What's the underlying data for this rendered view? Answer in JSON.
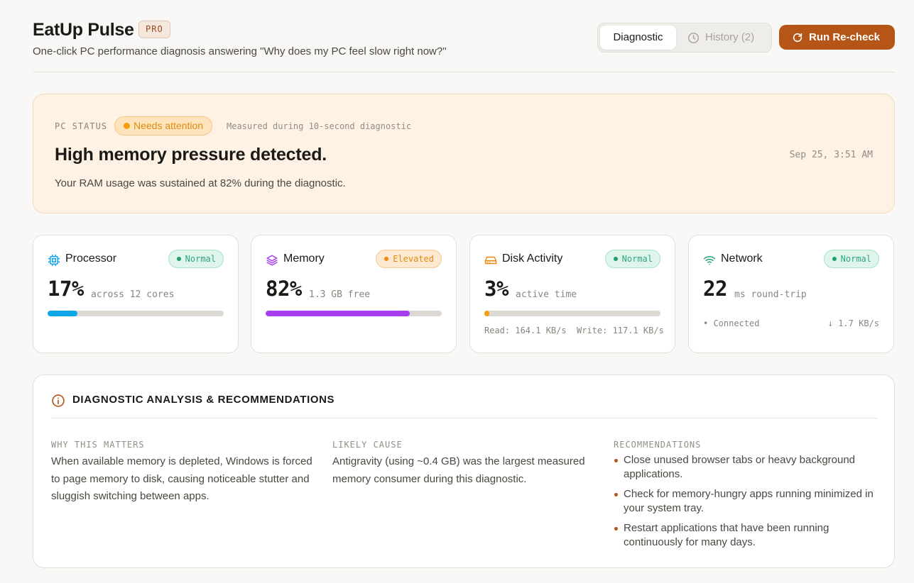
{
  "header": {
    "app_title": "EatUp Pulse",
    "badge": "PRO",
    "subtitle": "One-click PC performance diagnosis answering \"Why does my PC feel slow right now?\"",
    "tabs": [
      {
        "label": "Diagnostic",
        "active": true
      },
      {
        "label": "History (2)",
        "icon": "clock-icon",
        "active": false
      }
    ],
    "run_button": {
      "label": "Run Re-check",
      "icon": "refresh-icon"
    }
  },
  "status": {
    "eyebrow": "PC STATUS",
    "pill": "Needs attention",
    "measured_note": "Measured during 10-second diagnostic",
    "headline": "High memory pressure detected.",
    "timestamp": "Sep 25, 3:51 AM",
    "description": "Your RAM usage was sustained at 82% during the diagnostic."
  },
  "metrics": [
    {
      "name": "Processor",
      "icon": "cpu-chip-icon",
      "badge": "Normal",
      "value": "17%",
      "unit": "across 12 cores",
      "percent": 17,
      "bar_color": "#0ea5e9"
    },
    {
      "name": "Memory",
      "icon": "layers-icon",
      "badge": "Elevated",
      "value": "82%",
      "unit": "1.3 GB free",
      "percent": 82,
      "bar_color": "#a43ef0"
    },
    {
      "name": "Disk Activity",
      "icon": "hard-drive-icon",
      "badge": "Normal",
      "value": "3%",
      "unit": "active time",
      "percent": 3,
      "bar_color": "#f59e0b",
      "read": "Read: 164.1 KB/s",
      "write": "Write: 117.1 KB/s"
    },
    {
      "name": "Network",
      "icon": "wifi-icon",
      "badge": "Normal",
      "value": "22",
      "unit": "ms round-trip",
      "status": "• Connected",
      "throughput": "↓ 1.7 KB/s"
    }
  ],
  "analysis": {
    "title": "DIAGNOSTIC ANALYSIS & RECOMMENDATIONS",
    "icon": "info-circle-icon",
    "why": {
      "heading": "WHY THIS MATTERS",
      "text": "When available memory is depleted, Windows is forced to page memory to disk, causing noticeable stutter and sluggish switching between apps."
    },
    "cause": {
      "heading": "LIKELY CAUSE",
      "text": "Antigravity (using ~0.4 GB) was the largest measured memory consumer during this diagnostic."
    },
    "recommendations": {
      "heading": "RECOMMENDATIONS",
      "items": [
        "Close unused browser tabs or heavy background applications.",
        "Check for memory-hungry apps running minimized in your system tray.",
        "Restart applications that have been running continuously for many days."
      ]
    }
  },
  "colors": {
    "accent": "#b65518",
    "status_bg": "#fdf2e4",
    "normal": "#1fa06f",
    "elevated": "#f08a0b"
  }
}
